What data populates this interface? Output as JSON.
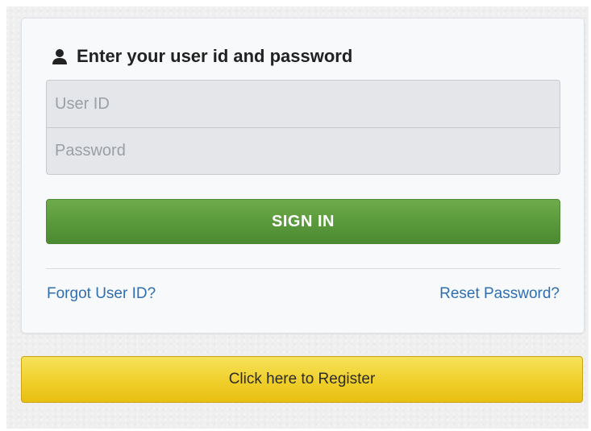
{
  "login": {
    "title": "Enter your user id and password",
    "user_id": {
      "value": "",
      "placeholder": "User ID"
    },
    "password": {
      "value": "",
      "placeholder": "Password"
    },
    "sign_in_label": "SIGN IN",
    "forgot_user_id_label": "Forgot User ID?",
    "reset_password_label": "Reset Password?",
    "title_icon": "user-icon"
  },
  "register": {
    "label": "Click here to Register"
  },
  "colors": {
    "sign_in": "#5b9a3c",
    "register": "#f0cf2b",
    "link": "#2f6fb0"
  }
}
